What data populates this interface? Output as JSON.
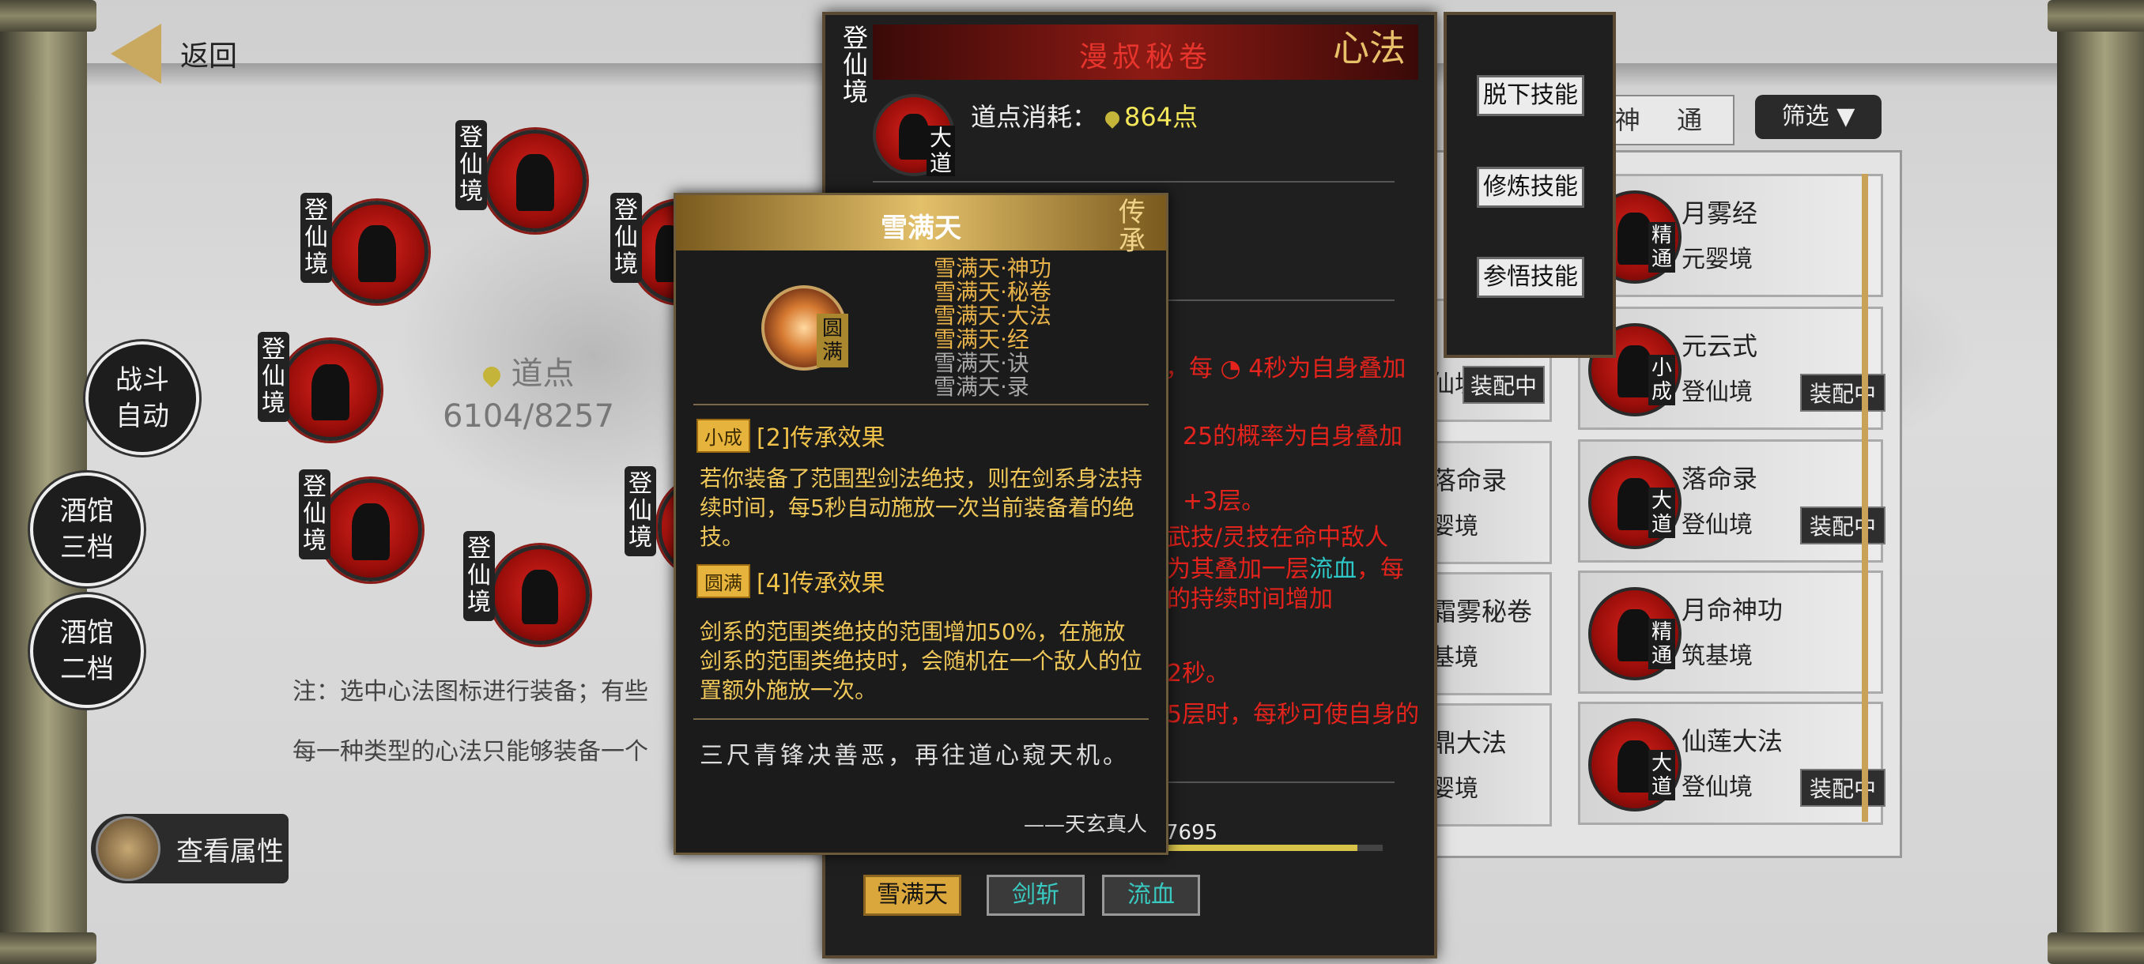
{
  "nav": {
    "back_label": "返回"
  },
  "side_buttons": {
    "auto_battle": "战斗\n自动",
    "tavern3": "酒馆\n三档",
    "tavern2": "酒馆\n二档"
  },
  "realm_label": "登仙境",
  "dao_points": {
    "label": "道点",
    "value": "6104/8257"
  },
  "notes": {
    "line1": "注：选中心法图标进行装备；有些",
    "line2": "每一种类型的心法只能够装备一个"
  },
  "view_attr": {
    "label": "查看属性"
  },
  "tabs": {
    "current": "神 通",
    "filter": "筛选 ▼"
  },
  "list": [
    {
      "name": "月雾经",
      "grade": "精通",
      "realm": "元婴境",
      "equipped": ""
    },
    {
      "name": "元云式",
      "grade": "小成",
      "realm": "登仙境",
      "equipped": "装配中"
    },
    {
      "name": "落命录",
      "grade": "大道",
      "realm": "登仙境",
      "equipped": "装配中"
    },
    {
      "name": "月命神功",
      "grade": "精通",
      "realm": "筑基境",
      "equipped": ""
    },
    {
      "name": "仙莲大法",
      "grade": "大道",
      "realm": "登仙境",
      "equipped": "装配中"
    }
  ],
  "partial_list": [
    {
      "name": "",
      "realm": "仙境",
      "equipped": "装配中"
    },
    {
      "name": "落命录",
      "realm": "婴境",
      "equipped": ""
    },
    {
      "name": "霜雾秘卷",
      "realm": "基境",
      "equipped": ""
    },
    {
      "name": "鼎大法",
      "realm": "婴境",
      "equipped": ""
    }
  ],
  "detail": {
    "title": "漫叔秘卷",
    "badge": "心法",
    "realm": "登仙境",
    "grade": "大道",
    "cost_label": "道点消耗：",
    "cost_value": "864点",
    "lines": [
      "，每 ◔ 4秒为自身叠加",
      "25的概率为自身叠加",
      "+3层。",
      "武技/灵技在命中敌人",
      "为其叠加一层",
      "的持续时间增加",
      "2秒。",
      "5层时，每秒可使自身的"
    ],
    "bleed": "流血",
    "bleed_tail": "，每",
    "progress_text": "7695",
    "progress_fraction": 0.93,
    "tabs": [
      "雪满天",
      "剑斩",
      "流血"
    ]
  },
  "menu": {
    "unequip": "脱下技能",
    "train": "修炼技能",
    "comprehend": "参悟技能"
  },
  "tooltip": {
    "title": "雪满天",
    "tag": "传承",
    "orb_grade": "圆满",
    "set": [
      {
        "name": "雪满天·神功",
        "active": true
      },
      {
        "name": "雪满天·秘卷",
        "active": true
      },
      {
        "name": "雪满天·大法",
        "active": true
      },
      {
        "name": "雪满天·经",
        "active": true
      },
      {
        "name": "雪满天·诀",
        "active": false
      },
      {
        "name": "雪满天·录",
        "active": false
      }
    ],
    "effect1_badge": "小成",
    "effect1_title": "[2]传承效果",
    "effect1_text": "若你装备了范围型剑法绝技，则在剑系身法持续时间，每5秒自动施放一次当前装备着的绝技。",
    "effect2_badge": "圆满",
    "effect2_title": "[4]传承效果",
    "effect2_text": "剑系的范围类绝技的范围增加50%，在施放剑系的范围类绝技时，会随机在一个敌人的位置额外施放一次。",
    "quote": "三尺青锋决善恶，再往道心窥天机。",
    "signature": "——天玄真人"
  },
  "colors": {
    "accent_red": "#e3231c",
    "gold": "#e8b24a",
    "cyan": "#2ec7c7",
    "panel": "#1f1f1f"
  }
}
